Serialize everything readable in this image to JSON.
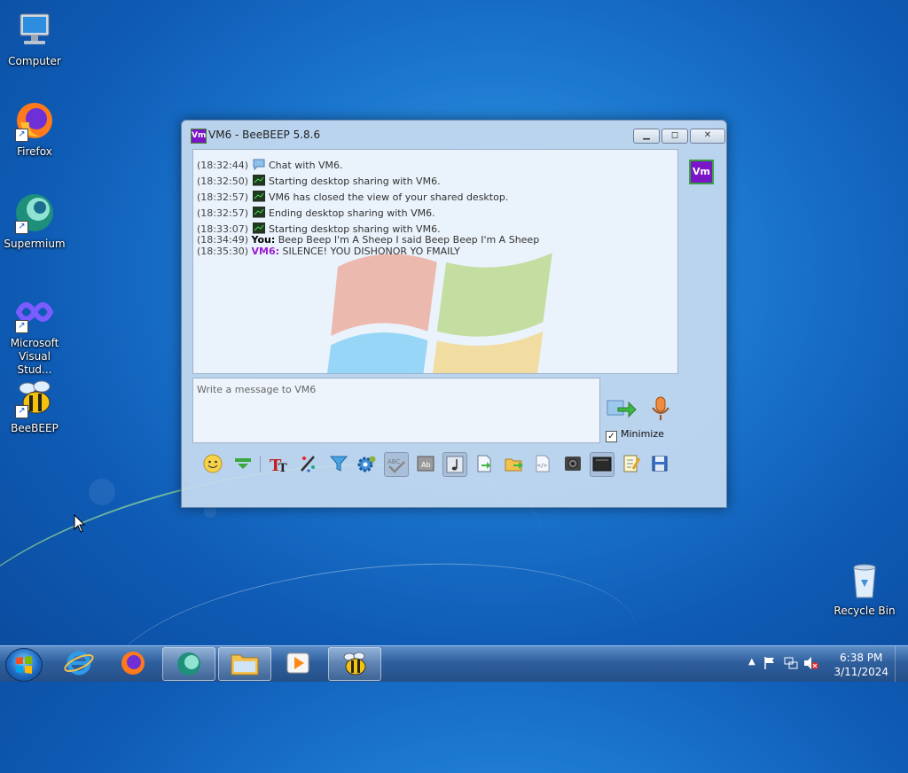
{
  "desktop": {
    "icons": [
      {
        "label": "Computer"
      },
      {
        "label": "Firefox"
      },
      {
        "label": "Supermium"
      },
      {
        "label": "Microsoft Visual Stud..."
      },
      {
        "label": "BeeBEEP"
      },
      {
        "label": "Recycle Bin"
      }
    ]
  },
  "window": {
    "icon_text": "Vm",
    "title": "VM6 - BeeBEEP 5.8.6",
    "messages": [
      {
        "time": "(18:32:44)",
        "icon": "chat-bubble-icon",
        "text": "Chat with VM6."
      },
      {
        "time": "(18:32:50)",
        "icon": "desktop-share-icon",
        "text": "Starting desktop sharing with VM6."
      },
      {
        "time": "(18:32:57)",
        "icon": "desktop-share-icon",
        "text": "VM6 has closed the view of your shared desktop."
      },
      {
        "time": "(18:32:57)",
        "icon": "desktop-share-icon",
        "text": "Ending desktop sharing with VM6."
      },
      {
        "time": "(18:33:07)",
        "icon": "desktop-share-icon",
        "text": "Starting desktop sharing with VM6."
      },
      {
        "time": "(18:34:49)",
        "sender": "You:",
        "text": " Beep Beep I'm A Sheep I said Beep Beep I'm A Sheep"
      },
      {
        "time": "(18:35:30)",
        "sender": "VM6:",
        "text": " SILENCE! YOU DISHONOR YO FMAILY"
      }
    ],
    "avatar_text": "Vm",
    "input_placeholder": "Write a message to VM6",
    "minimize_label": "Minimize",
    "minimize_checked": "✓"
  },
  "taskbar": {
    "time": "6:38 PM",
    "date": "3/11/2024"
  }
}
